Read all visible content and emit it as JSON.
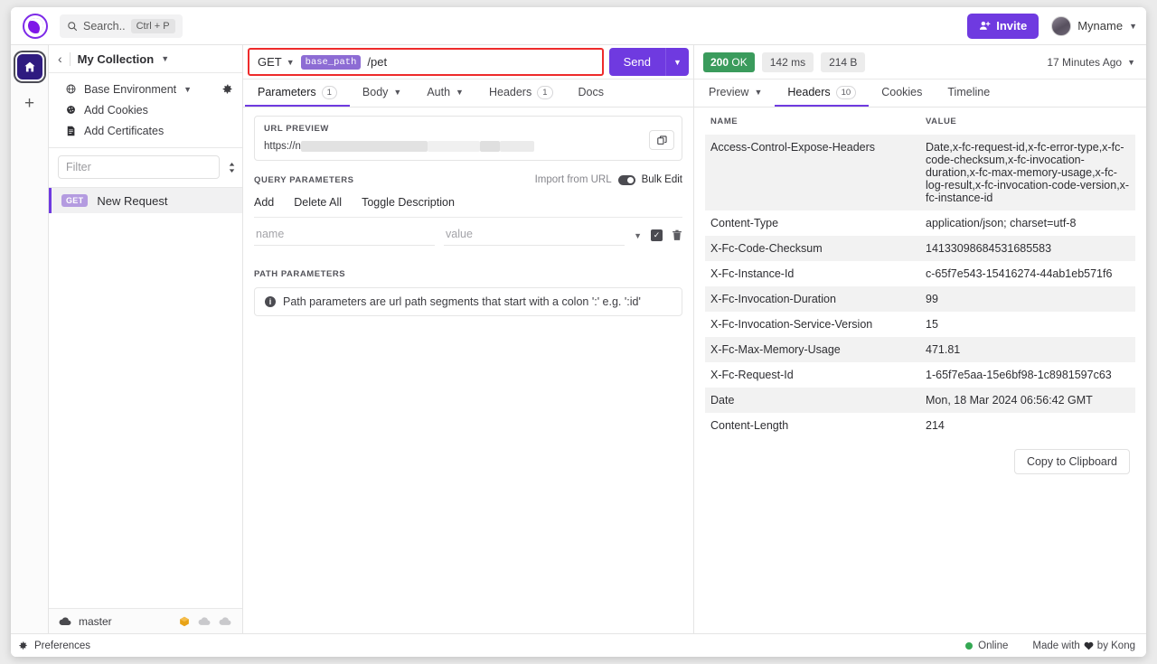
{
  "titlebar": {
    "search_placeholder": "Search..",
    "search_shortcut": "Ctrl + P",
    "invite_label": "Invite",
    "user_name": "Myname"
  },
  "activitybar": {
    "home_icon": "home-icon",
    "add_label": "+"
  },
  "sidebar": {
    "collection_name": "My Collection",
    "env_items": [
      {
        "label": "Base Environment",
        "icon": "globe-icon",
        "caret": true
      },
      {
        "label": "Add Cookies",
        "icon": "cookie-icon",
        "caret": false
      },
      {
        "label": "Add Certificates",
        "icon": "certificate-icon",
        "caret": false
      }
    ],
    "filter_placeholder": "Filter",
    "requests": [
      {
        "method": "GET",
        "name": "New Request"
      }
    ],
    "footer": {
      "branch": "master"
    }
  },
  "request": {
    "method": "GET",
    "url_template_tag": "base_path",
    "url_path": "/pet",
    "send_label": "Send",
    "tabs": [
      {
        "label": "Parameters",
        "count": "1",
        "active": true
      },
      {
        "label": "Body",
        "caret": true
      },
      {
        "label": "Auth",
        "caret": true
      },
      {
        "label": "Headers",
        "count": "1"
      },
      {
        "label": "Docs"
      }
    ],
    "url_preview": {
      "title": "URL PREVIEW",
      "value_prefix": "https://n"
    },
    "query_parameters": {
      "title": "QUERY PARAMETERS",
      "import_from_url": "Import from URL",
      "bulk_edit": "Bulk Edit",
      "actions": [
        "Add",
        "Delete All",
        "Toggle Description"
      ],
      "name_placeholder": "name",
      "value_placeholder": "value"
    },
    "path_parameters": {
      "title": "PATH PARAMETERS",
      "note": "Path parameters are url path segments that start with a colon ':' e.g. ':id'"
    }
  },
  "response": {
    "status_code": "200",
    "status_text": "OK",
    "time": "142 ms",
    "size": "214 B",
    "timestamp": "17 Minutes Ago",
    "tabs": [
      {
        "label": "Preview",
        "caret": true
      },
      {
        "label": "Headers",
        "count": "10",
        "active": true
      },
      {
        "label": "Cookies"
      },
      {
        "label": "Timeline"
      }
    ],
    "table": {
      "col_name": "NAME",
      "col_value": "VALUE",
      "rows": [
        {
          "name": "Access-Control-Expose-Headers",
          "value": "Date,x-fc-request-id,x-fc-error-type,x-fc-code-checksum,x-fc-invocation-duration,x-fc-max-memory-usage,x-fc-log-result,x-fc-invocation-code-version,x-fc-instance-id"
        },
        {
          "name": "Content-Type",
          "value": "application/json; charset=utf-8"
        },
        {
          "name": "X-Fc-Code-Checksum",
          "value": "14133098684531685583"
        },
        {
          "name": "X-Fc-Instance-Id",
          "value": "c-65f7e543-15416274-44ab1eb571f6"
        },
        {
          "name": "X-Fc-Invocation-Duration",
          "value": "99"
        },
        {
          "name": "X-Fc-Invocation-Service-Version",
          "value": "15"
        },
        {
          "name": "X-Fc-Max-Memory-Usage",
          "value": "471.81"
        },
        {
          "name": "X-Fc-Request-Id",
          "value": "1-65f7e5aa-15e6bf98-1c8981597c63"
        },
        {
          "name": "Date",
          "value": "Mon, 18 Mar 2024 06:56:42 GMT"
        },
        {
          "name": "Content-Length",
          "value": "214"
        }
      ]
    },
    "copy_to_clipboard": "Copy to Clipboard"
  },
  "statusbar": {
    "preferences": "Preferences",
    "online": "Online",
    "made_with_pre": "Made with",
    "made_with_post": "by Kong"
  },
  "colors": {
    "brand_purple": "#6f3ae0",
    "status_green": "#3a9b5c",
    "highlight_red": "#ee2b2b",
    "method_badge": "#b49be0"
  }
}
